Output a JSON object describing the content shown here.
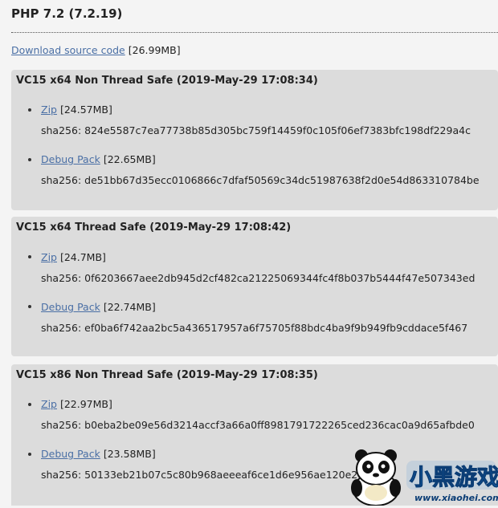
{
  "release": {
    "title": "PHP 7.2 (7.2.19)",
    "source_link_label": "Download source code",
    "source_size": "[26.99MB]"
  },
  "builds": [
    {
      "title": "VC15 x64 Non Thread Safe (2019-May-29 17:08:34)",
      "zip_label": "Zip",
      "zip_size": "[24.57MB]",
      "zip_sha": "sha256: 824e5587c7ea77738b85d305bc759f14459f0c105f06ef7383bfc198df229a4c",
      "debug_label": "Debug Pack",
      "debug_size": "[22.65MB]",
      "debug_sha": "sha256: de51bb67d35ecc0106866c7dfaf50569c34dc51987638f2d0e54d863310784be"
    },
    {
      "title": "VC15 x64 Thread Safe (2019-May-29 17:08:42)",
      "zip_label": "Zip",
      "zip_size": "[24.7MB]",
      "zip_sha": "sha256: 0f6203667aee2db945d2cf482ca21225069344fc4f8b037b5444f47e507343ed",
      "debug_label": "Debug Pack",
      "debug_size": "[22.74MB]",
      "debug_sha": "sha256: ef0ba6f742aa2bc5a436517957a6f75705f88bdc4ba9f9b949fb9cddace5f467"
    },
    {
      "title": "VC15 x86 Non Thread Safe (2019-May-29 17:08:35)",
      "zip_label": "Zip",
      "zip_size": "[22.97MB]",
      "zip_sha": "sha256: b0eba2be09e56d3214accf3a66a0ff8981791722265ced236cac0a9d65afbde0",
      "debug_label": "Debug Pack",
      "debug_size": "[23.58MB]",
      "debug_sha": "sha256: 50133eb21b07c5c80b968aeeeaf6ce1d6e956ae120e2ceb"
    }
  ],
  "watermark": {
    "brand_text": "小黑游戏",
    "url_text": "www.xiaohei.com"
  },
  "colors": {
    "link": "#4a6fa5",
    "box_background": "#dcdcdc",
    "page_background": "#f4f4f4",
    "watermark_blue": "#1a7fd8"
  }
}
